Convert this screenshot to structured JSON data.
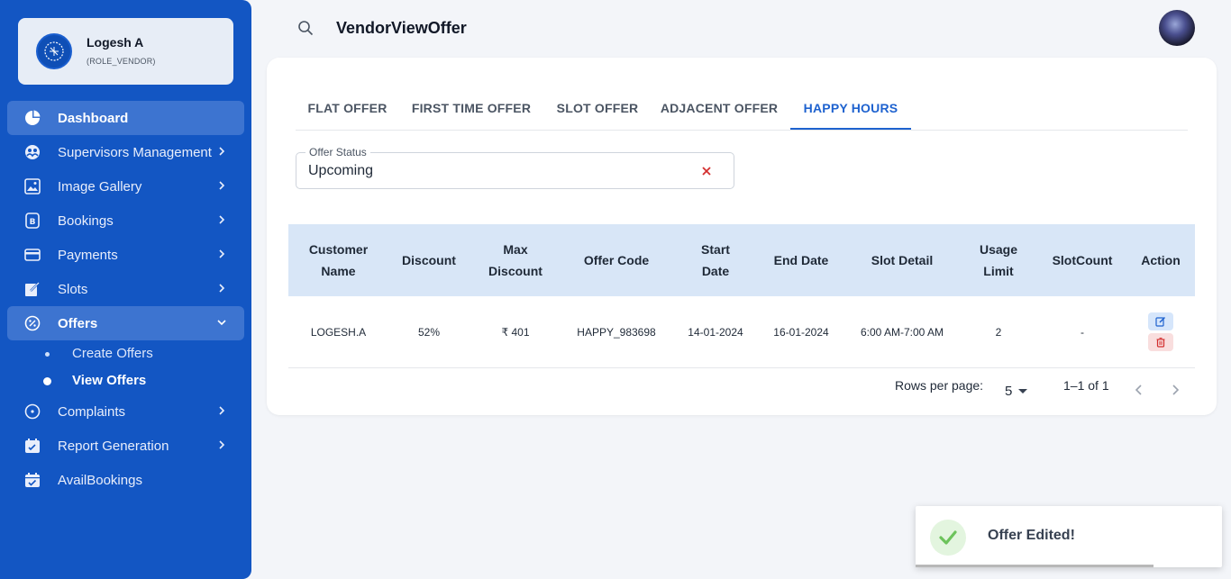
{
  "user": {
    "name": "Logesh A",
    "role": "(ROLE_VENDOR)"
  },
  "sidebar": {
    "items": [
      {
        "label": "Dashboard",
        "icon": "pie-chart-icon"
      },
      {
        "label": "Supervisors Management",
        "icon": "team-icon"
      },
      {
        "label": "Image Gallery",
        "icon": "image-gallery-icon"
      },
      {
        "label": "Bookings",
        "icon": "bookings-icon"
      },
      {
        "label": "Payments",
        "icon": "credit-card-icon"
      },
      {
        "label": "Slots",
        "icon": "edit-note-icon"
      },
      {
        "label": "Offers",
        "icon": "discount-icon"
      },
      {
        "label": "Complaints",
        "icon": "complaint-icon"
      },
      {
        "label": "Report Generation",
        "icon": "report-icon"
      },
      {
        "label": "AvailBookings",
        "icon": "calendar-check-icon"
      }
    ],
    "offers_sub": [
      {
        "label": "Create Offers"
      },
      {
        "label": "View Offers"
      }
    ]
  },
  "header": {
    "title": "VendorViewOffer"
  },
  "tabs": [
    {
      "label": "FLAT OFFER"
    },
    {
      "label": "FIRST TIME OFFER"
    },
    {
      "label": "SLOT OFFER"
    },
    {
      "label": "ADJACENT OFFER"
    },
    {
      "label": "HAPPY HOURS"
    }
  ],
  "active_tab": "HAPPY HOURS",
  "filter": {
    "label": "Offer Status",
    "value": "Upcoming"
  },
  "table": {
    "columns": [
      {
        "line1": "Customer",
        "line2": "Name"
      },
      {
        "line1": "Discount",
        "line2": ""
      },
      {
        "line1": "Max",
        "line2": "Discount"
      },
      {
        "line1": "Offer Code",
        "line2": ""
      },
      {
        "line1": "Start",
        "line2": "Date"
      },
      {
        "line1": "End Date",
        "line2": ""
      },
      {
        "line1": "Slot Detail",
        "line2": ""
      },
      {
        "line1": "Usage",
        "line2": "Limit"
      },
      {
        "line1": "SlotCount",
        "line2": ""
      },
      {
        "line1": "Action",
        "line2": ""
      }
    ],
    "rows": [
      {
        "customer": "LOGESH.A",
        "discount": "52%",
        "max_discount": "₹ 401",
        "code": "HAPPY_983698",
        "start": "14-01-2024",
        "end": "16-01-2024",
        "slot": "6:00 AM-7:00 AM",
        "usage": "2",
        "slot_count": "-"
      }
    ]
  },
  "pagination": {
    "rows_label": "Rows per page:",
    "rows_value": "5",
    "range": "1–1 of 1"
  },
  "toast": {
    "message": "Offer Edited!"
  },
  "colors": {
    "sidebar": "#1356c3",
    "accent": "#1e62cf",
    "table_header": "#d8e6f7",
    "success": "#6cc35b"
  }
}
